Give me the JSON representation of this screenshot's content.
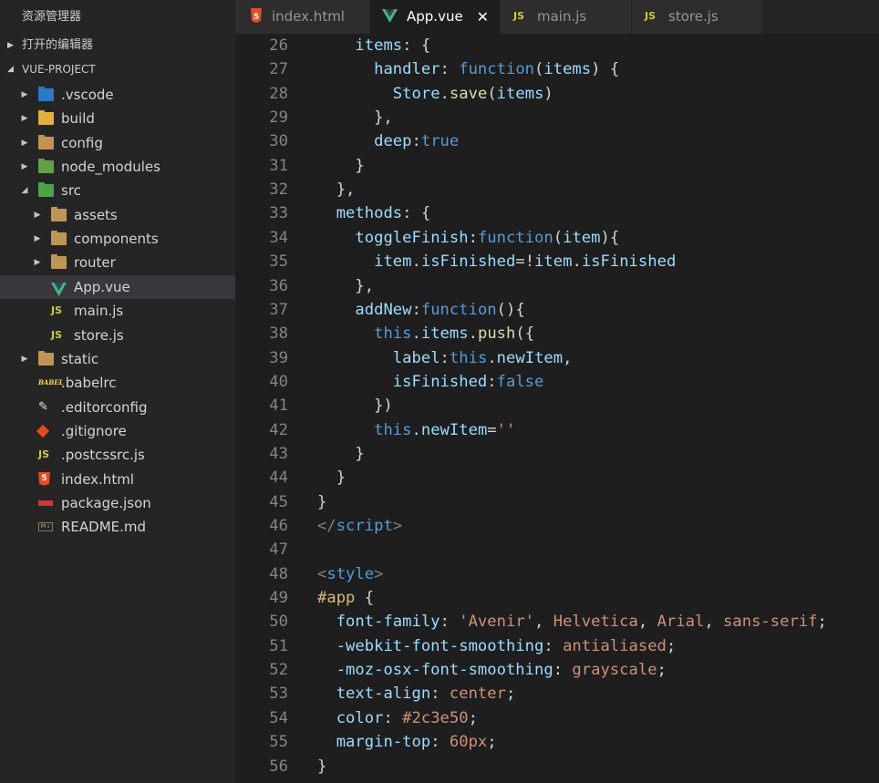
{
  "sidebar": {
    "title": "资源管理器",
    "open_editors_label": "打开的编辑器",
    "project_label": "VUE-PROJECT",
    "tree": [
      {
        "label": ".vscode",
        "icon": "vscode-folder-icon",
        "depth": 0,
        "folder": true,
        "expanded": false
      },
      {
        "label": "build",
        "icon": "build-folder-icon",
        "depth": 0,
        "folder": true,
        "expanded": false
      },
      {
        "label": "config",
        "icon": "folder-icon",
        "depth": 0,
        "folder": true,
        "expanded": false
      },
      {
        "label": "node_modules",
        "icon": "node-folder-icon",
        "depth": 0,
        "folder": true,
        "expanded": false
      },
      {
        "label": "src",
        "icon": "src-folder-icon",
        "depth": 0,
        "folder": true,
        "expanded": true
      },
      {
        "label": "assets",
        "icon": "folder-icon",
        "depth": 1,
        "folder": true,
        "expanded": false
      },
      {
        "label": "components",
        "icon": "folder-icon",
        "depth": 1,
        "folder": true,
        "expanded": false
      },
      {
        "label": "router",
        "icon": "folder-icon",
        "depth": 1,
        "folder": true,
        "expanded": false
      },
      {
        "label": "App.vue",
        "icon": "vue-icon",
        "depth": 1,
        "folder": false,
        "selected": true
      },
      {
        "label": "main.js",
        "icon": "js-icon",
        "depth": 1,
        "folder": false
      },
      {
        "label": "store.js",
        "icon": "js-icon",
        "depth": 1,
        "folder": false
      },
      {
        "label": "static",
        "icon": "folder-icon",
        "depth": 0,
        "folder": true,
        "expanded": false
      },
      {
        "label": ".babelrc",
        "icon": "babel-icon",
        "depth": 0,
        "folder": false
      },
      {
        "label": ".editorconfig",
        "icon": "editorconfig-icon",
        "depth": 0,
        "folder": false
      },
      {
        "label": ".gitignore",
        "icon": "git-icon",
        "depth": 0,
        "folder": false
      },
      {
        "label": ".postcssrc.js",
        "icon": "js-icon",
        "depth": 0,
        "folder": false
      },
      {
        "label": "index.html",
        "icon": "html5-icon",
        "depth": 0,
        "folder": false
      },
      {
        "label": "package.json",
        "icon": "npm-icon",
        "depth": 0,
        "folder": false
      },
      {
        "label": "README.md",
        "icon": "markdown-icon",
        "depth": 0,
        "folder": false
      }
    ]
  },
  "tabs": [
    {
      "label": "index.html",
      "icon": "html5-icon",
      "active": false
    },
    {
      "label": "App.vue",
      "icon": "vue-icon",
      "active": true,
      "close": "✕"
    },
    {
      "label": "main.js",
      "icon": "js-icon",
      "active": false
    },
    {
      "label": "store.js",
      "icon": "js-icon",
      "active": false
    }
  ],
  "colors": {
    "background": "#1e1e1e",
    "sidebar": "#252526",
    "property": "#9cdcfe",
    "keyword": "#569cd6",
    "function": "#dcdcaa",
    "string": "#ce9178",
    "line_number": "#858585"
  },
  "editor": {
    "lines": [
      {
        "n": "26",
        "tokens": [
          [
            "    ",
            "d"
          ],
          [
            "items",
            "p"
          ],
          [
            ": {",
            "d"
          ]
        ]
      },
      {
        "n": "27",
        "tokens": [
          [
            "      ",
            "d"
          ],
          [
            "handler",
            "p"
          ],
          [
            ": ",
            "d"
          ],
          [
            "function",
            "k"
          ],
          [
            "(",
            "d"
          ],
          [
            "items",
            "p"
          ],
          [
            ") {",
            "d"
          ]
        ]
      },
      {
        "n": "28",
        "tokens": [
          [
            "        ",
            "d"
          ],
          [
            "Store",
            "p"
          ],
          [
            ".",
            "d"
          ],
          [
            "save",
            "f"
          ],
          [
            "(",
            "d"
          ],
          [
            "items",
            "p"
          ],
          [
            ")",
            "d"
          ]
        ]
      },
      {
        "n": "29",
        "tokens": [
          [
            "      },",
            "d"
          ]
        ]
      },
      {
        "n": "30",
        "tokens": [
          [
            "      ",
            "d"
          ],
          [
            "deep",
            "p"
          ],
          [
            ":",
            "d"
          ],
          [
            "true",
            "k"
          ]
        ]
      },
      {
        "n": "31",
        "tokens": [
          [
            "    }",
            "d"
          ]
        ]
      },
      {
        "n": "32",
        "tokens": [
          [
            "  },",
            "d"
          ]
        ]
      },
      {
        "n": "33",
        "tokens": [
          [
            "  ",
            "d"
          ],
          [
            "methods",
            "p"
          ],
          [
            ": {",
            "d"
          ]
        ]
      },
      {
        "n": "34",
        "tokens": [
          [
            "    ",
            "d"
          ],
          [
            "toggleFinish",
            "p"
          ],
          [
            ":",
            "d"
          ],
          [
            "function",
            "k"
          ],
          [
            "(",
            "d"
          ],
          [
            "item",
            "p"
          ],
          [
            "){",
            "d"
          ]
        ]
      },
      {
        "n": "35",
        "tokens": [
          [
            "      ",
            "d"
          ],
          [
            "item",
            "p"
          ],
          [
            ".",
            "d"
          ],
          [
            "isFinished",
            "p"
          ],
          [
            "=!",
            "d"
          ],
          [
            "item",
            "p"
          ],
          [
            ".",
            "d"
          ],
          [
            "isFinished",
            "p"
          ]
        ]
      },
      {
        "n": "36",
        "tokens": [
          [
            "    },",
            "d"
          ]
        ]
      },
      {
        "n": "37",
        "tokens": [
          [
            "    ",
            "d"
          ],
          [
            "addNew",
            "p"
          ],
          [
            ":",
            "d"
          ],
          [
            "function",
            "k"
          ],
          [
            "(){",
            "d"
          ]
        ]
      },
      {
        "n": "38",
        "tokens": [
          [
            "      ",
            "d"
          ],
          [
            "this",
            "k"
          ],
          [
            ".",
            "d"
          ],
          [
            "items",
            "p"
          ],
          [
            ".",
            "d"
          ],
          [
            "push",
            "f"
          ],
          [
            "({",
            "d"
          ]
        ]
      },
      {
        "n": "39",
        "tokens": [
          [
            "        ",
            "d"
          ],
          [
            "label",
            "p"
          ],
          [
            ":",
            "d"
          ],
          [
            "this",
            "k"
          ],
          [
            ".",
            "d"
          ],
          [
            "newItem",
            "p"
          ],
          [
            ",",
            "d"
          ]
        ]
      },
      {
        "n": "40",
        "tokens": [
          [
            "        ",
            "d"
          ],
          [
            "isFinished",
            "p"
          ],
          [
            ":",
            "d"
          ],
          [
            "false",
            "k"
          ]
        ]
      },
      {
        "n": "41",
        "tokens": [
          [
            "      })",
            "d"
          ]
        ]
      },
      {
        "n": "42",
        "tokens": [
          [
            "      ",
            "d"
          ],
          [
            "this",
            "k"
          ],
          [
            ".",
            "d"
          ],
          [
            "newItem",
            "p"
          ],
          [
            "=",
            "d"
          ],
          [
            "''",
            "s"
          ]
        ]
      },
      {
        "n": "43",
        "tokens": [
          [
            "    }",
            "d"
          ]
        ]
      },
      {
        "n": "44",
        "tokens": [
          [
            "  }",
            "d"
          ]
        ]
      },
      {
        "n": "45",
        "tokens": [
          [
            "}",
            "d"
          ]
        ]
      },
      {
        "n": "46",
        "tokens": [
          [
            "</",
            "g"
          ],
          [
            "script",
            "k"
          ],
          [
            ">",
            "g"
          ]
        ]
      },
      {
        "n": "47",
        "tokens": []
      },
      {
        "n": "48",
        "tokens": [
          [
            "<",
            "g"
          ],
          [
            "style",
            "k"
          ],
          [
            ">",
            "g"
          ]
        ]
      },
      {
        "n": "49",
        "tokens": [
          [
            "#app",
            "sel"
          ],
          [
            " {",
            "d"
          ]
        ]
      },
      {
        "n": "50",
        "tokens": [
          [
            "  ",
            "d"
          ],
          [
            "font-family",
            "p"
          ],
          [
            ": ",
            "d"
          ],
          [
            "'Avenir'",
            "s"
          ],
          [
            ", ",
            "d"
          ],
          [
            "Helvetica",
            "s"
          ],
          [
            ", ",
            "d"
          ],
          [
            "Arial",
            "s"
          ],
          [
            ", ",
            "d"
          ],
          [
            "sans-serif",
            "s"
          ],
          [
            ";",
            "d"
          ]
        ]
      },
      {
        "n": "51",
        "tokens": [
          [
            "  ",
            "d"
          ],
          [
            "-webkit-font-smoothing",
            "p"
          ],
          [
            ": ",
            "d"
          ],
          [
            "antialiased",
            "s"
          ],
          [
            ";",
            "d"
          ]
        ]
      },
      {
        "n": "52",
        "tokens": [
          [
            "  ",
            "d"
          ],
          [
            "-moz-osx-font-smoothing",
            "p"
          ],
          [
            ": ",
            "d"
          ],
          [
            "grayscale",
            "s"
          ],
          [
            ";",
            "d"
          ]
        ]
      },
      {
        "n": "53",
        "tokens": [
          [
            "  ",
            "d"
          ],
          [
            "text-align",
            "p"
          ],
          [
            ": ",
            "d"
          ],
          [
            "center",
            "s"
          ],
          [
            ";",
            "d"
          ]
        ]
      },
      {
        "n": "54",
        "tokens": [
          [
            "  ",
            "d"
          ],
          [
            "color",
            "p"
          ],
          [
            ": ",
            "d"
          ],
          [
            "#2c3e50",
            "s"
          ],
          [
            ";",
            "d"
          ]
        ]
      },
      {
        "n": "55",
        "tokens": [
          [
            "  ",
            "d"
          ],
          [
            "margin-top",
            "p"
          ],
          [
            ": ",
            "d"
          ],
          [
            "60px",
            "s"
          ],
          [
            ";",
            "d"
          ]
        ]
      },
      {
        "n": "56",
        "tokens": [
          [
            "}",
            "d"
          ]
        ]
      }
    ]
  }
}
